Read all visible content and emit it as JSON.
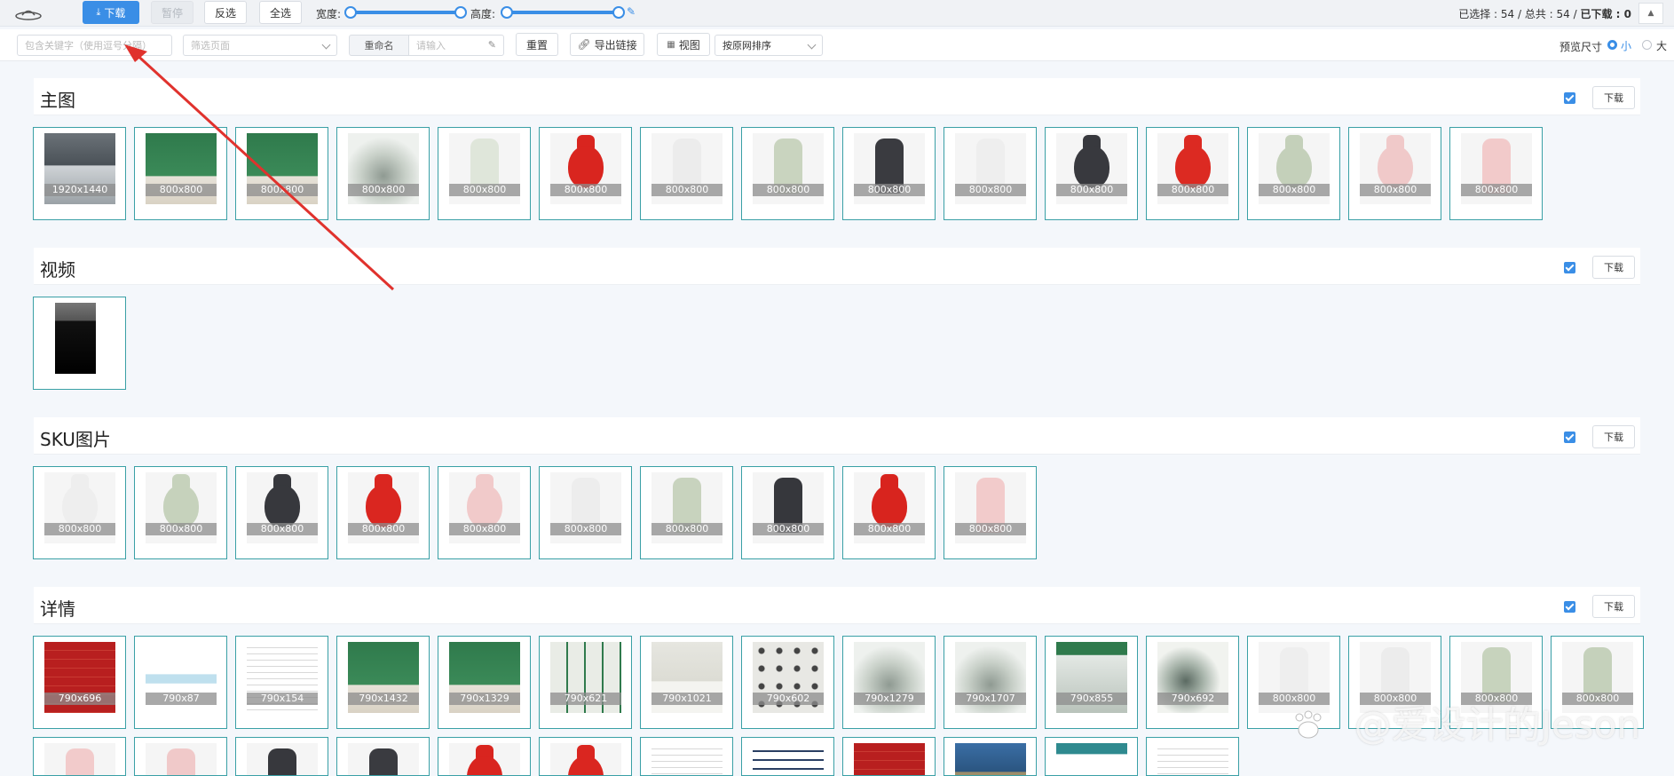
{
  "toolbar": {
    "download_label": "下载",
    "pause_label": "暂停",
    "invert_label": "反选",
    "select_all_label": "全选",
    "width_label": "宽度:",
    "height_label": "高度:",
    "status_selected_label": "已选择 : 54",
    "status_separator": " / ",
    "status_total_label": "总共 : 54",
    "status_downloaded_label": "已下载 : 0",
    "collapse_icon": "caret-up-icon"
  },
  "filters": {
    "keyword_placeholder": "包含关键字（使用逗号分隔）",
    "page_filter_placeholder": "筛选页面",
    "rename_label": "重命名",
    "rename_placeholder": "请输入",
    "reset_label": "重置",
    "export_links_label": "导出链接",
    "view_label": "视图",
    "sort_value": "按原网排序",
    "preview_size_label": "预览尺寸",
    "size_small_label": "小",
    "size_large_label": "大",
    "size_selected": "small"
  },
  "sections": [
    {
      "title": "主图",
      "download_label": "下载",
      "items": [
        {
          "dim": "1920x1440",
          "kind": "store"
        },
        {
          "dim": "800x800",
          "kind": "green-hand"
        },
        {
          "dim": "800x800",
          "kind": "green-box"
        },
        {
          "dim": "800x800",
          "kind": "lid-316"
        },
        {
          "dim": "800x800",
          "kind": "bottle",
          "color": "#dfe6da"
        },
        {
          "dim": "800x800",
          "kind": "round",
          "color": "#d9251f"
        },
        {
          "dim": "800x800",
          "kind": "bottle",
          "color": "#ececec"
        },
        {
          "dim": "800x800",
          "kind": "bottle",
          "color": "#c9d4bf"
        },
        {
          "dim": "800x800",
          "kind": "bottle",
          "color": "#3a3b40"
        },
        {
          "dim": "800x800",
          "kind": "bottle",
          "color": "#eeeeee"
        },
        {
          "dim": "800x800",
          "kind": "round",
          "color": "#38393e"
        },
        {
          "dim": "800x800",
          "kind": "round",
          "color": "#dc2a22"
        },
        {
          "dim": "800x800",
          "kind": "round",
          "color": "#c4d0ba"
        },
        {
          "dim": "800x800",
          "kind": "round",
          "color": "#f0c9c9"
        },
        {
          "dim": "800x800",
          "kind": "bottle",
          "color": "#f2caca"
        }
      ]
    },
    {
      "title": "视频",
      "download_label": "下载",
      "items": [
        {
          "dim": "",
          "kind": "video"
        }
      ]
    },
    {
      "title": "SKU图片",
      "download_label": "下载",
      "items": [
        {
          "dim": "800x800",
          "kind": "round",
          "color": "#eeeeee"
        },
        {
          "dim": "800x800",
          "kind": "round",
          "color": "#c6d2bc"
        },
        {
          "dim": "800x800",
          "kind": "round",
          "color": "#37383d"
        },
        {
          "dim": "800x800",
          "kind": "round",
          "color": "#da2620"
        },
        {
          "dim": "800x800",
          "kind": "round",
          "color": "#f1caca"
        },
        {
          "dim": "800x800",
          "kind": "bottle",
          "color": "#ededed"
        },
        {
          "dim": "800x800",
          "kind": "bottle",
          "color": "#c8d3be"
        },
        {
          "dim": "800x800",
          "kind": "bottle",
          "color": "#36373c"
        },
        {
          "dim": "800x800",
          "kind": "round",
          "color": "#d8241e"
        },
        {
          "dim": "800x800",
          "kind": "bottle",
          "color": "#f2cbcb"
        }
      ]
    },
    {
      "title": "详情",
      "download_label": "下载",
      "items": [
        {
          "dim": "790x696",
          "kind": "red-doc"
        },
        {
          "dim": "790x87",
          "kind": "banner"
        },
        {
          "dim": "790x154",
          "kind": "text-strip"
        },
        {
          "dim": "790x1432",
          "kind": "green-poster"
        },
        {
          "dim": "790x1329",
          "kind": "green-poster2"
        },
        {
          "dim": "790x621",
          "kind": "green-grid"
        },
        {
          "dim": "790x1021",
          "kind": "spec"
        },
        {
          "dim": "790x602",
          "kind": "icons"
        },
        {
          "dim": "790x1279",
          "kind": "green-white"
        },
        {
          "dim": "790x1707",
          "kind": "lid-316"
        },
        {
          "dim": "790x855",
          "kind": "mouth"
        },
        {
          "dim": "790x692",
          "kind": "green-lid"
        },
        {
          "dim": "800x800",
          "kind": "bottle",
          "color": "#eeeeee"
        },
        {
          "dim": "800x800",
          "kind": "bottle",
          "color": "#ececec"
        },
        {
          "dim": "800x800",
          "kind": "bottle",
          "color": "#c7d3bd"
        },
        {
          "dim": "800x800",
          "kind": "bottle",
          "color": "#c5d1bb"
        }
      ],
      "row2": [
        {
          "kind": "bottle",
          "color": "#f2cbcb"
        },
        {
          "kind": "bottle",
          "color": "#f0c9c9"
        },
        {
          "kind": "bottle",
          "color": "#37383d"
        },
        {
          "kind": "bottle",
          "color": "#3a3b40"
        },
        {
          "kind": "round",
          "color": "#d9251f"
        },
        {
          "kind": "round",
          "color": "#da2620"
        },
        {
          "kind": "text-doc"
        },
        {
          "kind": "table-doc"
        },
        {
          "kind": "red-doc"
        },
        {
          "kind": "factory"
        },
        {
          "kind": "teal-doc"
        },
        {
          "kind": "text-doc"
        }
      ]
    }
  ],
  "watermark": "@爱设计的Jeson",
  "colors": {
    "accent": "#3a8ee6",
    "tile_border": "#3aa0a6",
    "annotation_arrow": "#e0322d"
  }
}
